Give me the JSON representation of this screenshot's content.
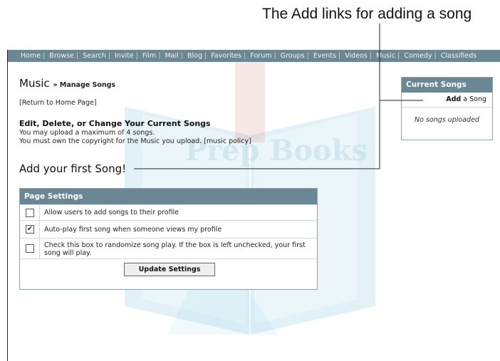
{
  "callout": {
    "text": "The Add links for adding a song"
  },
  "nav": {
    "items": [
      "Home",
      "Browse",
      "Search",
      "Invite",
      "Film",
      "Mail",
      "Blog",
      "Favorites",
      "Forum",
      "Groups",
      "Events",
      "Videos",
      "Music",
      "Comedy",
      "Classifieds"
    ]
  },
  "page": {
    "title": "Music",
    "crumb": "» Manage Songs",
    "return_link": "[Return to Home Page]",
    "edit_heading": "Edit, Delete, or Change Your Current Songs",
    "info_max": "You may upload a maximum of 4 songs.",
    "info_copyright": "You must own the copyright for the Music you upload.",
    "music_policy_link": "[music policy]",
    "add_first": "Add your first Song!"
  },
  "settings": {
    "header": "Page Settings",
    "options": [
      {
        "label": "Allow users to add songs to their profile",
        "checked": false,
        "mark": ""
      },
      {
        "label": "Auto-play first song when someone views my profile",
        "checked": true,
        "mark": "✔"
      },
      {
        "label": "Check this box to randomize song play. If the box is left unchecked, your first song will play.",
        "checked": false,
        "mark": ""
      }
    ],
    "update_button": "Update Settings"
  },
  "sidebar": {
    "header": "Current Songs",
    "add_bold": "Add",
    "add_rest": " a Song",
    "empty_text": "No songs uploaded"
  },
  "watermark": {
    "text": "Prep Books"
  },
  "colors": {
    "nav_bg": "#6b8794",
    "panel_border": "#8ea3ad"
  }
}
